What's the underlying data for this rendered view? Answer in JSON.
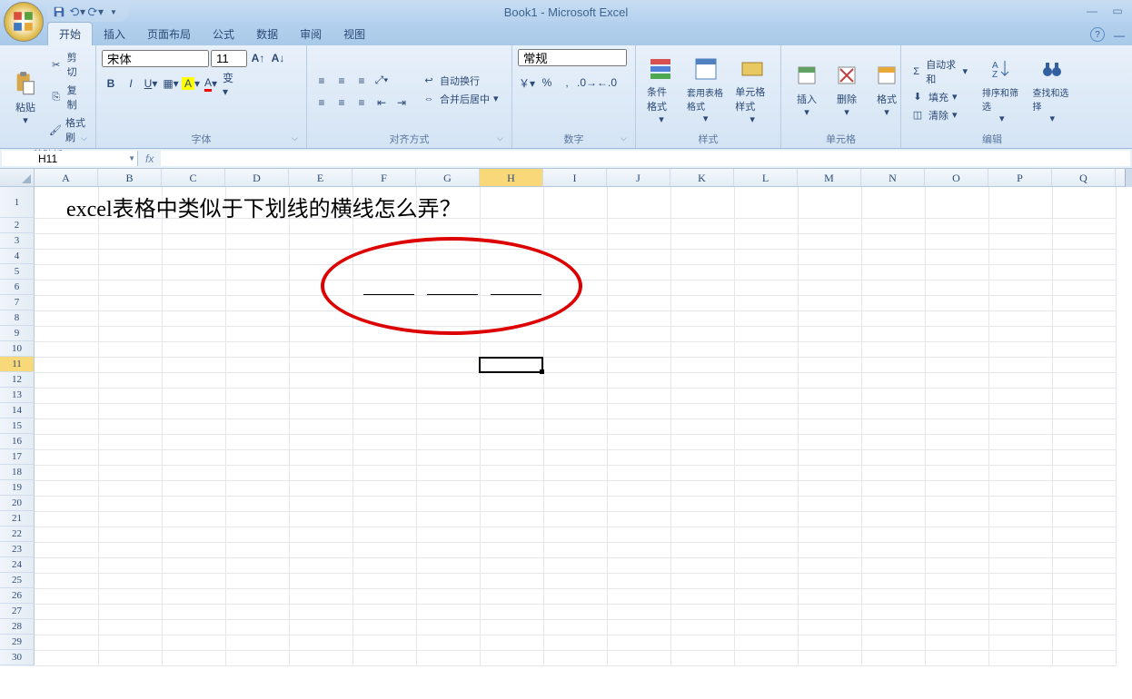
{
  "app": {
    "title": "Book1 - Microsoft Excel"
  },
  "tabs": {
    "t0": "开始",
    "t1": "插入",
    "t2": "页面布局",
    "t3": "公式",
    "t4": "数据",
    "t5": "审阅",
    "t6": "视图"
  },
  "groups": {
    "clipboard": {
      "label": "剪贴板",
      "paste": "粘贴",
      "cut": "剪切",
      "copy": "复制",
      "painter": "格式刷"
    },
    "font": {
      "label": "字体",
      "name": "宋体",
      "size": "11"
    },
    "align": {
      "label": "对齐方式",
      "wrap": "自动换行",
      "merge": "合并后居中"
    },
    "number": {
      "label": "数字",
      "format": "常规"
    },
    "styles": {
      "label": "样式",
      "cond": "条件格式",
      "tbl": "套用表格格式",
      "cell": "单元格样式"
    },
    "cells": {
      "label": "单元格",
      "insert": "插入",
      "delete": "删除",
      "format": "格式"
    },
    "editing": {
      "label": "编辑",
      "sum": "自动求和",
      "fill": "填充",
      "clear": "清除",
      "sort": "排序和筛选",
      "find": "查找和选择"
    }
  },
  "name_box": "H11",
  "fx_label": "fx",
  "columns": [
    "A",
    "B",
    "C",
    "D",
    "E",
    "F",
    "G",
    "H",
    "I",
    "J",
    "K",
    "L",
    "M",
    "N",
    "O",
    "P",
    "Q"
  ],
  "row_count": 30,
  "active": {
    "col": "H",
    "row": 11
  },
  "cell_text": "excel表格中类似于下划线的横线怎么弄？",
  "underscored_cells": [
    "F7",
    "G7",
    "H7"
  ]
}
